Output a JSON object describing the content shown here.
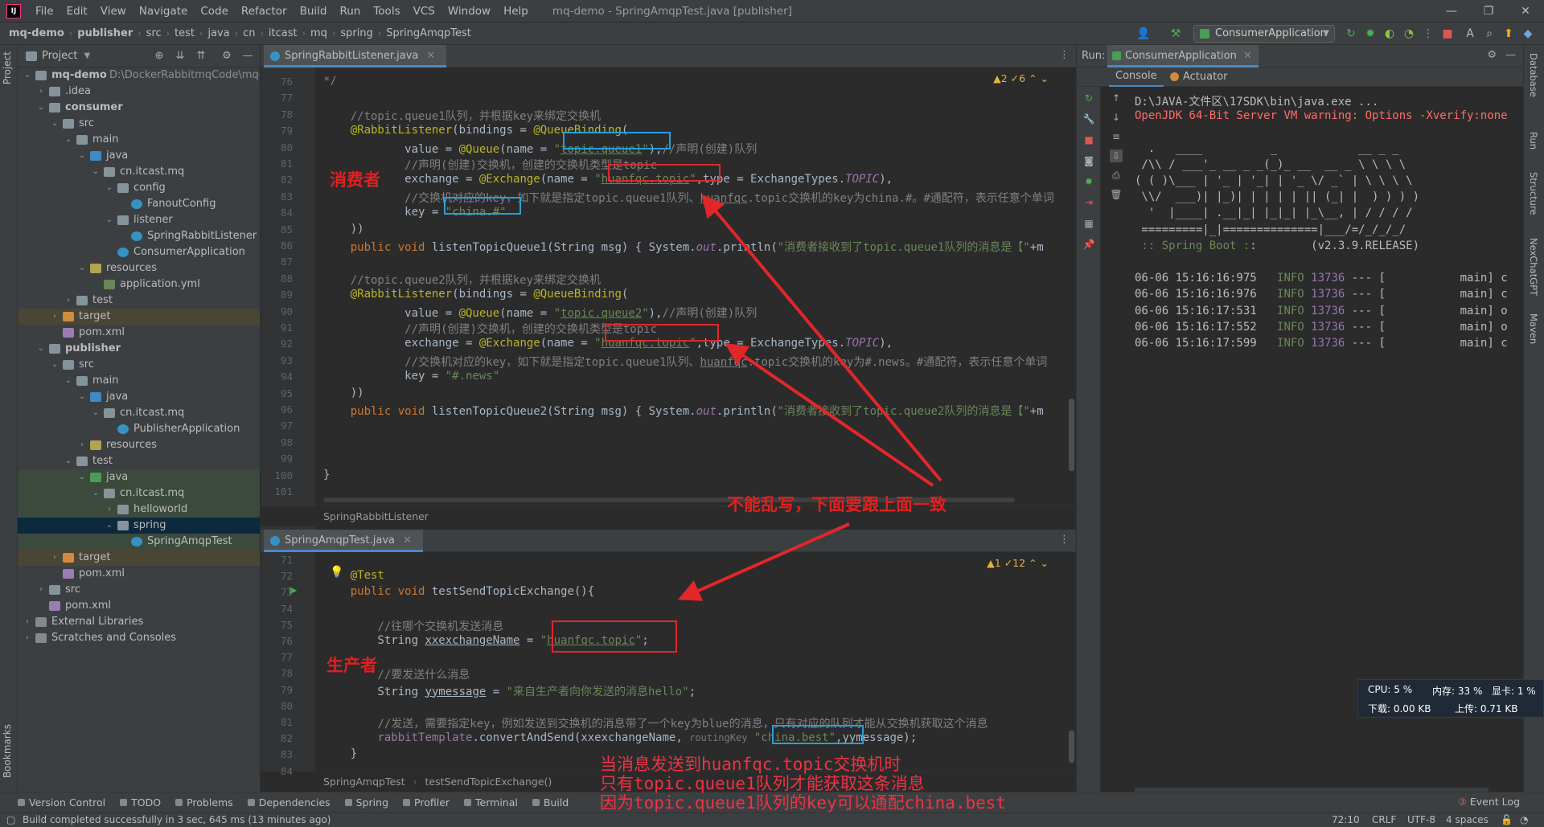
{
  "menubar": {
    "items": [
      "File",
      "Edit",
      "View",
      "Navigate",
      "Code",
      "Refactor",
      "Build",
      "Run",
      "Tools",
      "VCS",
      "Window",
      "Help"
    ],
    "window_title": "mq-demo - SpringAmqpTest.java [publisher]"
  },
  "navbar": {
    "crumbs": [
      "mq-demo",
      "publisher",
      "src",
      "test",
      "java",
      "cn",
      "itcast",
      "mq",
      "spring",
      "SpringAmqpTest"
    ],
    "run_config": "ConsumerApplication"
  },
  "left_strip": {
    "project_tab": "Project",
    "bookmarks_tab": "Bookmarks"
  },
  "project": {
    "title": "Project",
    "tree": [
      {
        "label": "mq-demo",
        "path": "D:\\DockerRabbitmqCode\\mq-de",
        "depth": 0,
        "arrow": "down",
        "icon": "folder",
        "bold": true
      },
      {
        "label": ".idea",
        "depth": 1,
        "arrow": "right",
        "icon": "folder"
      },
      {
        "label": "consumer",
        "depth": 1,
        "arrow": "down",
        "icon": "folder",
        "bold": true
      },
      {
        "label": "src",
        "depth": 2,
        "arrow": "down",
        "icon": "folder"
      },
      {
        "label": "main",
        "depth": 3,
        "arrow": "down",
        "icon": "folder"
      },
      {
        "label": "java",
        "depth": 4,
        "arrow": "down",
        "icon": "src"
      },
      {
        "label": "cn.itcast.mq",
        "depth": 5,
        "arrow": "down",
        "icon": "pkg"
      },
      {
        "label": "config",
        "depth": 6,
        "arrow": "down",
        "icon": "pkg"
      },
      {
        "label": "FanoutConfig",
        "depth": 7,
        "arrow": "",
        "icon": "class"
      },
      {
        "label": "listener",
        "depth": 6,
        "arrow": "down",
        "icon": "pkg"
      },
      {
        "label": "SpringRabbitListener",
        "depth": 7,
        "arrow": "",
        "icon": "class"
      },
      {
        "label": "ConsumerApplication",
        "depth": 6,
        "arrow": "",
        "icon": "class"
      },
      {
        "label": "resources",
        "depth": 4,
        "arrow": "down",
        "icon": "res"
      },
      {
        "label": "application.yml",
        "depth": 5,
        "arrow": "",
        "icon": "yml"
      },
      {
        "label": "test",
        "depth": 3,
        "arrow": "right",
        "icon": "folder"
      },
      {
        "label": "target",
        "depth": 2,
        "arrow": "right",
        "icon": "excl",
        "highlight": "olive"
      },
      {
        "label": "pom.xml",
        "depth": 2,
        "arrow": "",
        "icon": "file"
      },
      {
        "label": "publisher",
        "depth": 1,
        "arrow": "down",
        "icon": "folder",
        "bold": true
      },
      {
        "label": "src",
        "depth": 2,
        "arrow": "down",
        "icon": "folder"
      },
      {
        "label": "main",
        "depth": 3,
        "arrow": "down",
        "icon": "folder"
      },
      {
        "label": "java",
        "depth": 4,
        "arrow": "down",
        "icon": "src"
      },
      {
        "label": "cn.itcast.mq",
        "depth": 5,
        "arrow": "down",
        "icon": "pkg"
      },
      {
        "label": "PublisherApplication",
        "depth": 6,
        "arrow": "",
        "icon": "class"
      },
      {
        "label": "resources",
        "depth": 4,
        "arrow": "right",
        "icon": "res"
      },
      {
        "label": "test",
        "depth": 3,
        "arrow": "down",
        "icon": "folder"
      },
      {
        "label": "java",
        "depth": 4,
        "arrow": "down",
        "icon": "test",
        "highlight": "green"
      },
      {
        "label": "cn.itcast.mq",
        "depth": 5,
        "arrow": "down",
        "icon": "pkg",
        "highlight": "green"
      },
      {
        "label": "helloworld",
        "depth": 6,
        "arrow": "right",
        "icon": "pkg",
        "highlight": "green"
      },
      {
        "label": "spring",
        "depth": 6,
        "arrow": "down",
        "icon": "pkg",
        "highlight": "selected"
      },
      {
        "label": "SpringAmqpTest",
        "depth": 7,
        "arrow": "",
        "icon": "class",
        "highlight": "green"
      },
      {
        "label": "target",
        "depth": 2,
        "arrow": "right",
        "icon": "excl",
        "highlight": "olive"
      },
      {
        "label": "pom.xml",
        "depth": 2,
        "arrow": "",
        "icon": "file"
      },
      {
        "label": "src",
        "depth": 1,
        "arrow": "right",
        "icon": "folder"
      },
      {
        "label": "pom.xml",
        "depth": 1,
        "arrow": "",
        "icon": "file"
      },
      {
        "label": "External Libraries",
        "depth": 0,
        "arrow": "right",
        "icon": "lib"
      },
      {
        "label": "Scratches and Consoles",
        "depth": 0,
        "arrow": "right",
        "icon": "lib"
      }
    ]
  },
  "editor1": {
    "tab": "SpringRabbitListener.java",
    "warnings": "▲2  ✓6",
    "breadcrumb": "SpringRabbitListener",
    "lines": [
      {
        "n": "76",
        "html": "<span class='cm'>*/</span>"
      },
      {
        "n": "77",
        "html": ""
      },
      {
        "n": "78",
        "html": "    <span class='cm'>//topic.queue1队列，并根据key来绑定交换机</span>"
      },
      {
        "n": "79",
        "html": "    <span class='an'>@RabbitListener</span>(bindings = <span class='an'>@QueueBinding</span>("
      },
      {
        "n": "80",
        "html": "            value = <span class='an'>@Queue</span>(name = <span class='st'>\"<span class='ul'>topic.queue1</span>\"</span>),<span class='cm'>//声明(创建)队列</span>"
      },
      {
        "n": "81",
        "html": "            <span class='cm'>//声明(创建)交换机，创建的交换机类型是topic</span>"
      },
      {
        "n": "82",
        "html": "            exchange = <span class='an'>@Exchange</span>(name = <span class='st'>\"<span class='ul'>huanfqc.topic</span>\"</span>,type = ExchangeTypes.<span class='it'>TOPIC</span>),"
      },
      {
        "n": "83",
        "html": "            <span class='cm'>//交换机对应的key，如下就是指定topic.queue1队列、<span class='ul'>huanfqc</span>.topic交换机的key为china.#。#通配符，表示任意个单词</span>"
      },
      {
        "n": "84",
        "html": "            key = <span class='st'>\"china.#\"</span>"
      },
      {
        "n": "85",
        "html": "    ))"
      },
      {
        "n": "86",
        "html": "    <span class='kw'>public void</span> listenTopicQueue1(String msg) { System.<span class='it'>out</span>.println(<span class='st'>\"消费者接收到了topic.queue1队列的消息是【\"</span>+m"
      },
      {
        "n": "87",
        "html": ""
      },
      {
        "n": "88",
        "html": "    <span class='cm'>//topic.queue2队列，并根据key来绑定交换机</span>"
      },
      {
        "n": "89",
        "html": "    <span class='an'>@RabbitListener</span>(bindings = <span class='an'>@QueueBinding</span>("
      },
      {
        "n": "90",
        "html": "            value = <span class='an'>@Queue</span>(name = <span class='st'>\"<span class='ul'>topic.queue2</span>\"</span>),<span class='cm'>//声明(创建)队列</span>"
      },
      {
        "n": "91",
        "html": "            <span class='cm'>//声明(创建)交换机，创建的交换机类型是topic</span>"
      },
      {
        "n": "92",
        "html": "            exchange = <span class='an'>@Exchange</span>(name = <span class='st'>\"<span class='ul'>huanfqc.topic</span>\"</span>,type = ExchangeTypes.<span class='it'>TOPIC</span>),"
      },
      {
        "n": "93",
        "html": "            <span class='cm'>//交换机对应的key，如下就是指定topic.queue1队列、<span class='ul'>huanfqc</span>.topic交换机的key为#.news。#通配符，表示任意个单词</span>"
      },
      {
        "n": "94",
        "html": "            key = <span class='st'>\"#.news\"</span>"
      },
      {
        "n": "95",
        "html": "    ))"
      },
      {
        "n": "96",
        "html": "    <span class='kw'>public void</span> listenTopicQueue2(String msg) { System.<span class='it'>out</span>.println(<span class='st'>\"消费者接收到了topic.queue2队列的消息是【\"</span>+m"
      },
      {
        "n": "97",
        "html": ""
      },
      {
        "n": "98",
        "html": ""
      },
      {
        "n": "99",
        "html": ""
      },
      {
        "n": "100",
        "html": "}"
      },
      {
        "n": "101",
        "html": ""
      }
    ]
  },
  "editor2": {
    "tab": "SpringAmqpTest.java",
    "warnings": "▲1  ✓12",
    "breadcrumb": [
      "SpringAmqpTest",
      "testSendTopicExchange()"
    ],
    "lines": [
      {
        "n": "71",
        "html": ""
      },
      {
        "n": "72",
        "html": "    <span class='an'>@Test</span>"
      },
      {
        "n": "73",
        "html": "    <span class='kw'>public void</span> testSendTopicExchange(){"
      },
      {
        "n": "74",
        "html": ""
      },
      {
        "n": "75",
        "html": "        <span class='cm'>//往哪个交换机发送消息</span>"
      },
      {
        "n": "76",
        "html": "        String <span class='ul'>xxexchangeName</span> = <span class='st'>\"<span class='ul'>huanfqc.topic</span>\"</span>;"
      },
      {
        "n": "77",
        "html": ""
      },
      {
        "n": "78",
        "html": "        <span class='cm'>//要发送什么消息</span>"
      },
      {
        "n": "79",
        "html": "        String <span class='ul'>yymessage</span> = <span class='st'>\"来自生产者向你发送的消息hello\"</span>;"
      },
      {
        "n": "80",
        "html": ""
      },
      {
        "n": "81",
        "html": "        <span class='cm'>//发送，需要指定key，例如发送到交换机的消息带了一个key为blue的消息，只有对应的队列才能从交换机获取这个消息</span>"
      },
      {
        "n": "82",
        "html": "        <span class='it' style='color:#9876aa;font-style:normal'>rabbitTemplate</span>.convertAndSend(xxexchangeName, <span style='color:#787878;font-size:12px'>routingKey</span> <span class='st'>\"china.best\"</span>,yymessage);"
      },
      {
        "n": "83",
        "html": "    }"
      },
      {
        "n": "84",
        "html": ""
      }
    ]
  },
  "run": {
    "label": "Run:",
    "config_tab": "ConsumerApplication",
    "tabs": [
      "Console",
      "Actuator"
    ],
    "console": [
      {
        "text": "D:\\JAVA-文件区\\17SDK\\bin\\java.exe ...",
        "cls": ""
      },
      {
        "text": "OpenJDK 64-Bit Server VM warning: Options -Xverify:none",
        "cls": "red"
      },
      {
        "text": "",
        "cls": ""
      },
      {
        "text": "  .   ____          _            __ _ _",
        "cls": ""
      },
      {
        "text": " /\\\\ / ___'_ __ _ _(_)_ __  __ _ \\ \\ \\ \\",
        "cls": ""
      },
      {
        "text": "( ( )\\___ | '_ | '_| | '_ \\/ _` | \\ \\ \\ \\",
        "cls": ""
      },
      {
        "text": " \\\\/  ___)| |_)| | | | | || (_| |  ) ) ) )",
        "cls": ""
      },
      {
        "text": "  '  |____| .__|_| |_|_| |_\\__, | / / / /",
        "cls": ""
      },
      {
        "text": " =========|_|==============|___/=/_/_/_/",
        "cls": ""
      },
      {
        "text": " :: Spring Boot ::        (v2.3.9.RELEASE)",
        "cls": "boot"
      },
      {
        "text": "",
        "cls": ""
      },
      {
        "text": "06-06 15:16:16:975  INFO 13736 --- [           main] c",
        "cls": "log"
      },
      {
        "text": "06-06 15:16:16:976  INFO 13736 --- [           main] c",
        "cls": "log"
      },
      {
        "text": "06-06 15:16:17:531  INFO 13736 --- [           main] o",
        "cls": "log"
      },
      {
        "text": "06-06 15:16:17:552  INFO 13736 --- [           main] o",
        "cls": "log"
      },
      {
        "text": "06-06 15:16:17:599  INFO 13736 --- [           main] c",
        "cls": "log"
      }
    ]
  },
  "right_strip": [
    "Database",
    "Run",
    "Structure",
    "NexChatGPT",
    "Maven"
  ],
  "toolwindows": [
    "Version Control",
    "TODO",
    "Problems",
    "Dependencies",
    "Spring",
    "Profiler",
    "Terminal",
    "Build"
  ],
  "event_log": "Event Log",
  "status": {
    "message": "Build completed successfully in 3 sec, 645 ms (13 minutes ago)",
    "position": "72:10",
    "line_sep": "CRLF",
    "encoding": "UTF-8",
    "indent": "4 spaces"
  },
  "sysmon": {
    "cpu": "CPU: 5 %",
    "mem": "内存: 33 %",
    "gpu": "显卡: 1 %",
    "down": "下载: 0.00 KB",
    "up": "上传: 0.71 KB"
  },
  "annotations": {
    "consumer": "消费者",
    "producer": "生产者",
    "must_match": "不能乱写，下面要跟上面一致",
    "explain": [
      "当消息发送到huanfqc.topic交换机时",
      "只有topic.queue1队列才能获取这条消息",
      "因为topic.queue1队列的key可以通配china.best"
    ]
  },
  "colors": {
    "accent": "#4a88c7",
    "annotation_red": "#e3262a",
    "annotation_blue": "#2a9fd8"
  }
}
